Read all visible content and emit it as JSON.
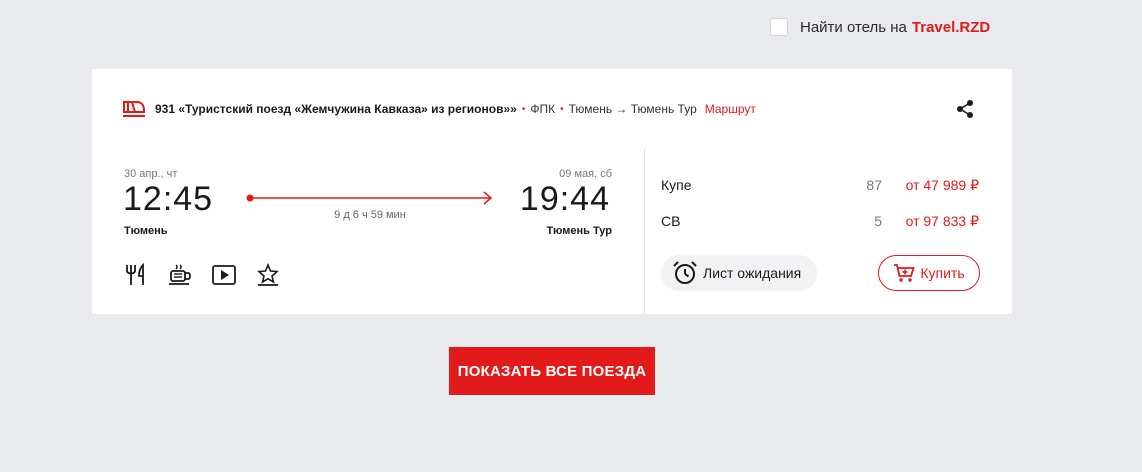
{
  "hotel": {
    "label": "Найти отель на",
    "link": "Travel.RZD"
  },
  "train": {
    "name": "931 «Туристский поезд «Жемчужина Кавказа» из регионов»»",
    "carrier": "ФПК",
    "route": "Тюмень → Тюмень Тур",
    "route_link": "Маршрут"
  },
  "departure": {
    "date": "30 апр., чт",
    "time": "12:45",
    "station": "Тюмень"
  },
  "arrival": {
    "date": "09 мая, сб",
    "time": "19:44",
    "station": "Тюмень Тур"
  },
  "duration": "9 д 6 ч 59 мин",
  "classes": [
    {
      "name": "Купе",
      "seats": "87",
      "price": "от 47 989 ₽"
    },
    {
      "name": "СВ",
      "seats": "5",
      "price": "от 97 833 ₽"
    }
  ],
  "amenities": [
    "restaurant-icon",
    "coffee-icon",
    "video-icon",
    "star-icon"
  ],
  "buttons": {
    "waitlist": "Лист ожидания",
    "buy": "Купить",
    "show_all": "ПОКАЗАТЬ ВСЕ ПОЕЗДА"
  },
  "colors": {
    "brand": "#e21a1a",
    "background": "#e9eaed"
  }
}
